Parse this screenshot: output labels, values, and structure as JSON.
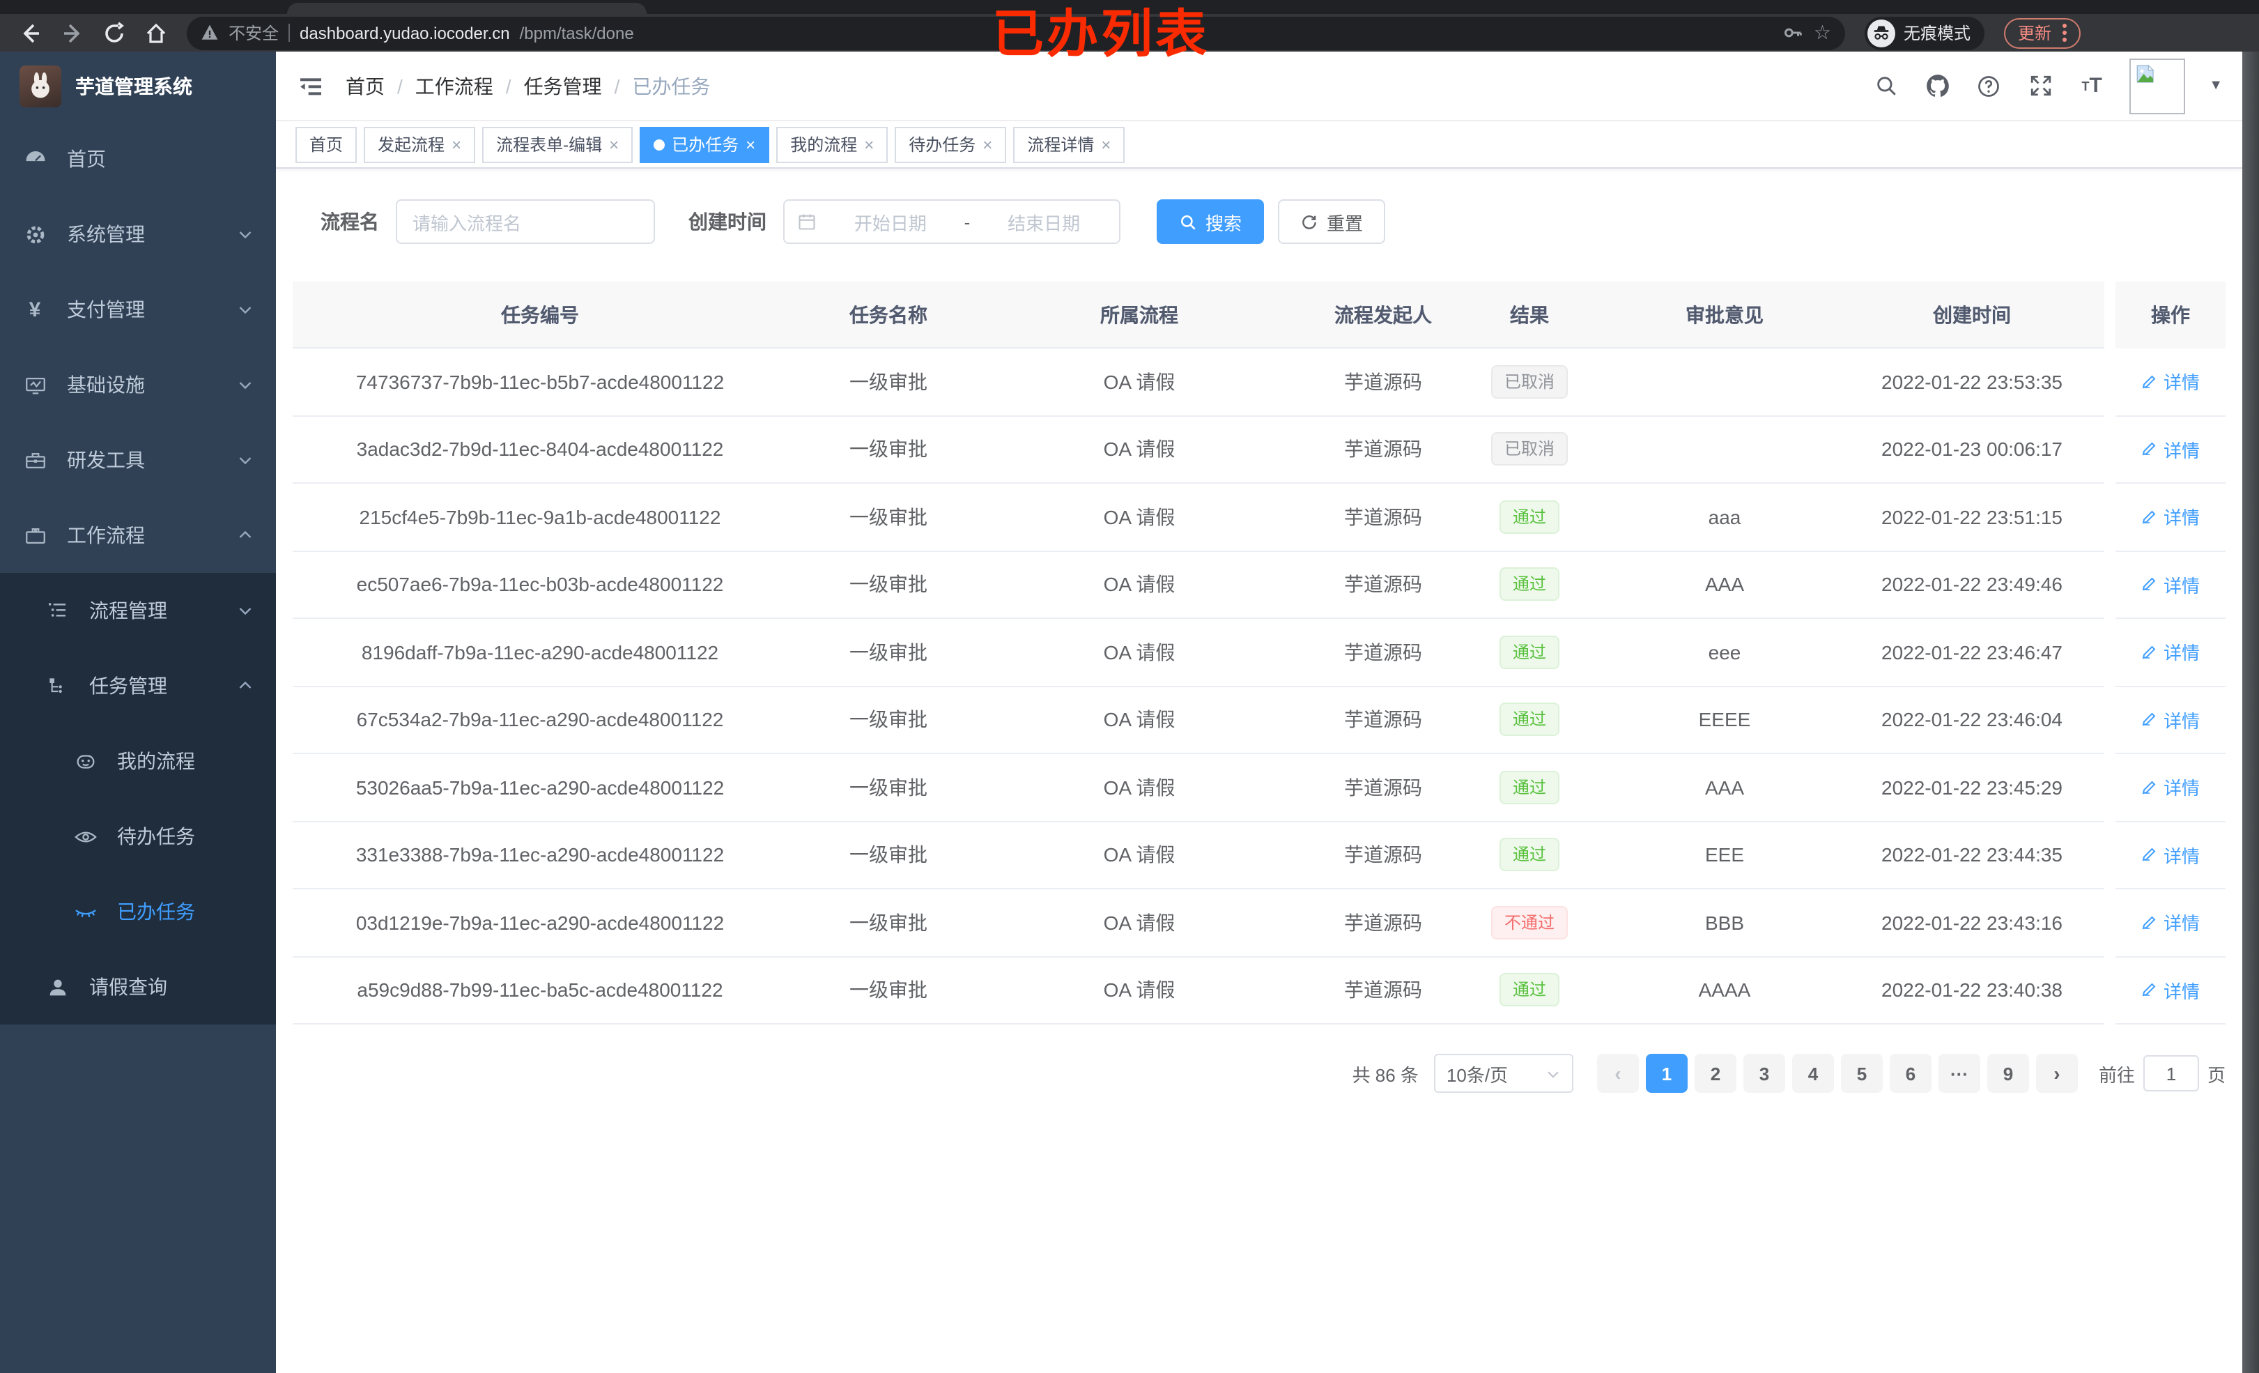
{
  "browser": {
    "security_label": "不安全",
    "url_host": "dashboard.yudao.iocoder.cn",
    "url_path": "/bpm/task/done",
    "incognito_label": "无痕模式",
    "update_label": "更新"
  },
  "annotation": "已办列表",
  "sidebar": {
    "title": "芋道管理系统",
    "items": [
      {
        "label": "首页"
      },
      {
        "label": "系统管理"
      },
      {
        "label": "支付管理"
      },
      {
        "label": "基础设施"
      },
      {
        "label": "研发工具"
      },
      {
        "label": "工作流程"
      }
    ],
    "sub": {
      "process_mgmt": "流程管理",
      "task_mgmt": "任务管理",
      "my_process": "我的流程",
      "todo_task": "待办任务",
      "done_task": "已办任务",
      "leave_query": "请假查询"
    }
  },
  "breadcrumb": {
    "items": [
      "首页",
      "工作流程",
      "任务管理",
      "已办任务"
    ]
  },
  "tabs": [
    {
      "label": "首页",
      "closable": false
    },
    {
      "label": "发起流程",
      "closable": true
    },
    {
      "label": "流程表单-编辑",
      "closable": true
    },
    {
      "label": "已办任务",
      "closable": true,
      "active": true
    },
    {
      "label": "我的流程",
      "closable": true
    },
    {
      "label": "待办任务",
      "closable": true
    },
    {
      "label": "流程详情",
      "closable": true
    }
  ],
  "filters": {
    "name_label": "流程名",
    "name_placeholder": "请输入流程名",
    "time_label": "创建时间",
    "start_placeholder": "开始日期",
    "end_placeholder": "结束日期",
    "search_label": "搜索",
    "reset_label": "重置"
  },
  "table": {
    "columns": [
      "任务编号",
      "任务名称",
      "所属流程",
      "流程发起人",
      "结果",
      "审批意见",
      "创建时间",
      "操作"
    ],
    "action_label": "详情",
    "rows": [
      {
        "id": "74736737-7b9b-11ec-b5b7-acde48001122",
        "name": "一级审批",
        "flow": "OA 请假",
        "starter": "芋道源码",
        "result": "已取消",
        "result_type": "info",
        "comment": "",
        "time": "2022-01-22 23:53:35"
      },
      {
        "id": "3adac3d2-7b9d-11ec-8404-acde48001122",
        "name": "一级审批",
        "flow": "OA 请假",
        "starter": "芋道源码",
        "result": "已取消",
        "result_type": "info",
        "comment": "",
        "time": "2022-01-23 00:06:17"
      },
      {
        "id": "215cf4e5-7b9b-11ec-9a1b-acde48001122",
        "name": "一级审批",
        "flow": "OA 请假",
        "starter": "芋道源码",
        "result": "通过",
        "result_type": "success",
        "comment": "aaa",
        "time": "2022-01-22 23:51:15"
      },
      {
        "id": "ec507ae6-7b9a-11ec-b03b-acde48001122",
        "name": "一级审批",
        "flow": "OA 请假",
        "starter": "芋道源码",
        "result": "通过",
        "result_type": "success",
        "comment": "AAA",
        "time": "2022-01-22 23:49:46"
      },
      {
        "id": "8196daff-7b9a-11ec-a290-acde48001122",
        "name": "一级审批",
        "flow": "OA 请假",
        "starter": "芋道源码",
        "result": "通过",
        "result_type": "success",
        "comment": "eee",
        "time": "2022-01-22 23:46:47"
      },
      {
        "id": "67c534a2-7b9a-11ec-a290-acde48001122",
        "name": "一级审批",
        "flow": "OA 请假",
        "starter": "芋道源码",
        "result": "通过",
        "result_type": "success",
        "comment": "EEEE",
        "time": "2022-01-22 23:46:04"
      },
      {
        "id": "53026aa5-7b9a-11ec-a290-acde48001122",
        "name": "一级审批",
        "flow": "OA 请假",
        "starter": "芋道源码",
        "result": "通过",
        "result_type": "success",
        "comment": "AAA",
        "time": "2022-01-22 23:45:29"
      },
      {
        "id": "331e3388-7b9a-11ec-a290-acde48001122",
        "name": "一级审批",
        "flow": "OA 请假",
        "starter": "芋道源码",
        "result": "通过",
        "result_type": "success",
        "comment": "EEE",
        "time": "2022-01-22 23:44:35"
      },
      {
        "id": "03d1219e-7b9a-11ec-a290-acde48001122",
        "name": "一级审批",
        "flow": "OA 请假",
        "starter": "芋道源码",
        "result": "不通过",
        "result_type": "danger",
        "comment": "BBB",
        "time": "2022-01-22 23:43:16"
      },
      {
        "id": "a59c9d88-7b99-11ec-ba5c-acde48001122",
        "name": "一级审批",
        "flow": "OA 请假",
        "starter": "芋道源码",
        "result": "通过",
        "result_type": "success",
        "comment": "AAAA",
        "time": "2022-01-22 23:40:38"
      }
    ]
  },
  "pagination": {
    "total_label": "共 86 条",
    "page_size_label": "10条/页",
    "pages": [
      {
        "label": "1",
        "active": true
      },
      {
        "label": "2"
      },
      {
        "label": "3"
      },
      {
        "label": "4"
      },
      {
        "label": "5"
      },
      {
        "label": "6"
      },
      {
        "label": "···"
      },
      {
        "label": "9"
      }
    ],
    "goto_label": "前往",
    "goto_value": "1",
    "goto_unit": "页"
  },
  "ui": {
    "close_glyph": "×",
    "breadcrumb_sep": "/",
    "range_sep": "-",
    "prev_glyph": "‹",
    "next_glyph": "›",
    "caret_glyph": "▼",
    "yen_glyph": "¥",
    "star_glyph": "☆",
    "font_size_glyph": "TT"
  },
  "colors": {
    "accent": "#409eff",
    "sidebar_bg": "#304156",
    "submenu_bg": "#1f2d3d",
    "annotation_red": "#fb2b01",
    "tag_success_text": "#59c13d",
    "tag_danger_text": "#f56c6c",
    "tag_info_text": "#909399",
    "chrome_update": "#f28b82"
  }
}
